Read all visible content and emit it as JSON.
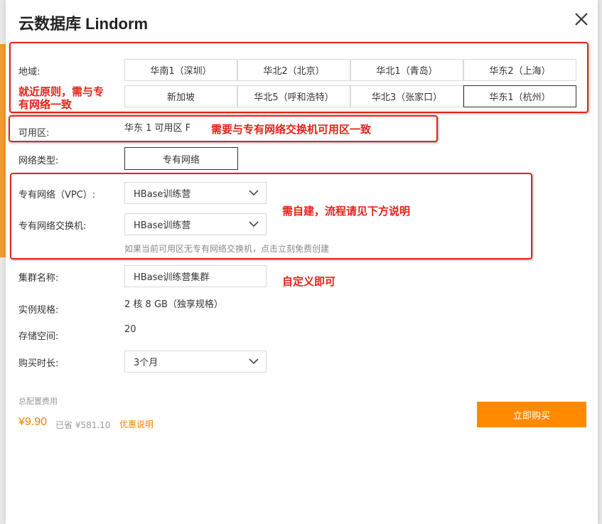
{
  "dialog": {
    "title": "云数据库 Lindorm"
  },
  "form": {
    "region_label": "地域:",
    "regions": [
      "华南1（深圳）",
      "华北2（北京）",
      "华北1（青岛）",
      "华东2（上海）",
      "新加坡",
      "华北5（呼和浩特）",
      "华北3（张家口）",
      "华东1（杭州）"
    ],
    "selected_region": "华东1（杭州）",
    "zone_label": "可用区:",
    "zone_value": "华东 1 可用区 F",
    "network_type_label": "网络类型:",
    "network_type_value": "专有网络",
    "vpc_label": "专有网络（VPC）:",
    "vpc_value": "HBase训练营",
    "vswitch_label": "专有网络交换机:",
    "vswitch_value": "HBase训练营",
    "vswitch_hint": "如果当前可用区无专有网络交换机，点击立刻免费创建",
    "cluster_name_label": "集群名称:",
    "cluster_name_value": "HBase训练营集群",
    "spec_label": "实例规格:",
    "spec_value": "2 核 8 GB（独享规格）",
    "storage_label": "存储空间:",
    "storage_value": "20",
    "duration_label": "购买时长:",
    "duration_value": "3个月"
  },
  "footer": {
    "fee_label": "总配置费用",
    "price": "¥9.90",
    "saved": "已省 ¥581.10",
    "promo_link": "优惠说明",
    "buy_button": "立即购买"
  },
  "annotations": {
    "region_note_line1": "就近原则，需与专",
    "region_note_line2": "有网络一致",
    "zone_note": "需要与专有网络交换机可用区一致",
    "vpc_note": "需自建，流程请见下方说明",
    "name_note": "自定义即可"
  },
  "colors": {
    "accent_orange": "#ff8a00",
    "annotation_red": "#e3231a",
    "price_orange": "#f08300"
  }
}
